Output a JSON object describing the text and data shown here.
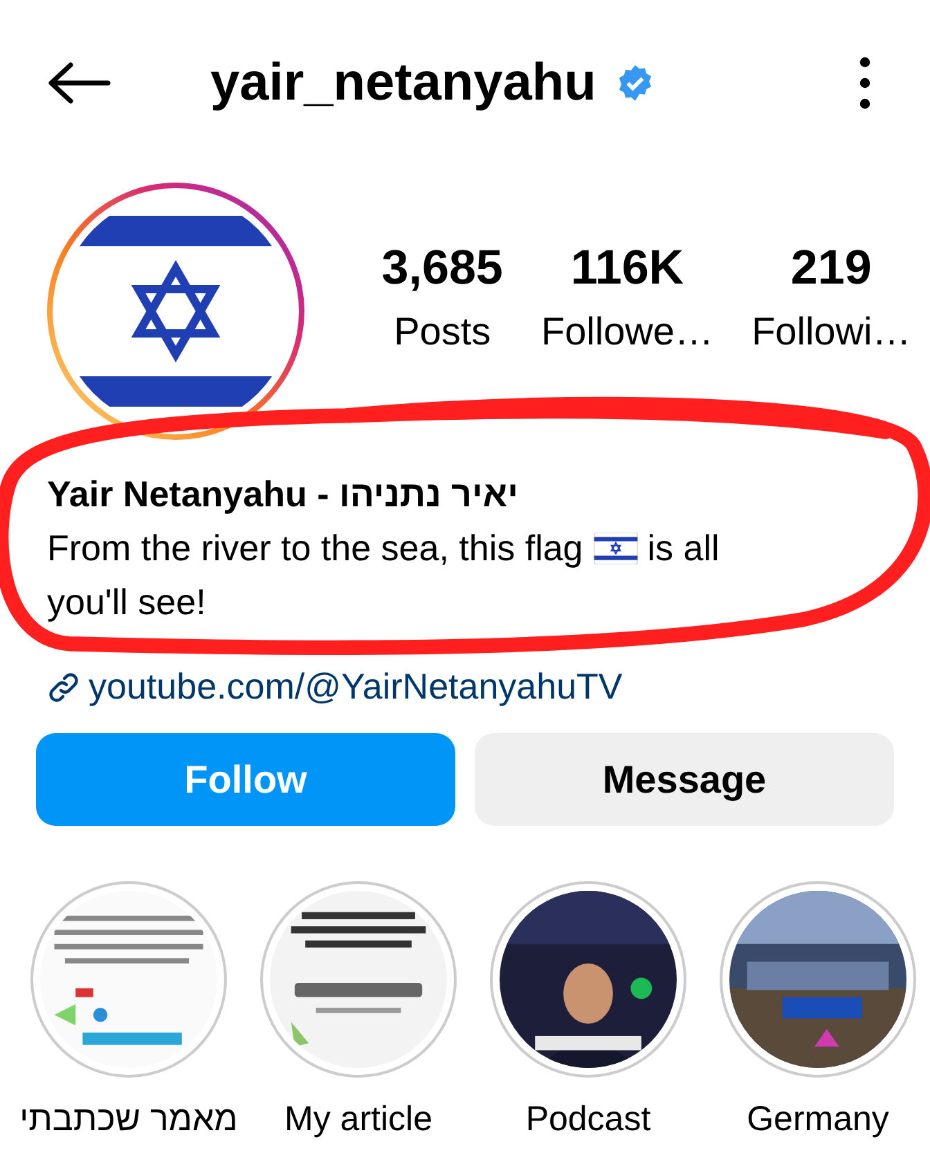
{
  "header": {
    "username": "yair_netanyahu",
    "verified": true
  },
  "profile": {
    "kind": "flag"
  },
  "stats": [
    {
      "value": "3,685",
      "label": "Posts"
    },
    {
      "value": "116K",
      "label": "Followe…"
    },
    {
      "value": "219",
      "label": "Followi…"
    }
  ],
  "bio": {
    "name": "Yair Netanyahu - יאיר נתניהו",
    "text_before_flag": "From the river to the sea, this flag",
    "text_after_flag": "is all",
    "text_next_line": "you'll see!",
    "link": "youtube.com/@YairNetanyahuTV"
  },
  "annotation": {
    "kind": "red_circle"
  },
  "buttons": [
    {
      "label": "Follow",
      "kind": "primary"
    },
    {
      "label": "Message",
      "kind": "secondary"
    }
  ],
  "highlights": [
    {
      "label": "מאמר שכתבתי",
      "kind": "picture"
    },
    {
      "label": "My article",
      "kind": "picture"
    },
    {
      "label": "Podcast",
      "kind": "picture"
    },
    {
      "label": "Germany",
      "kind": "picture"
    }
  ]
}
